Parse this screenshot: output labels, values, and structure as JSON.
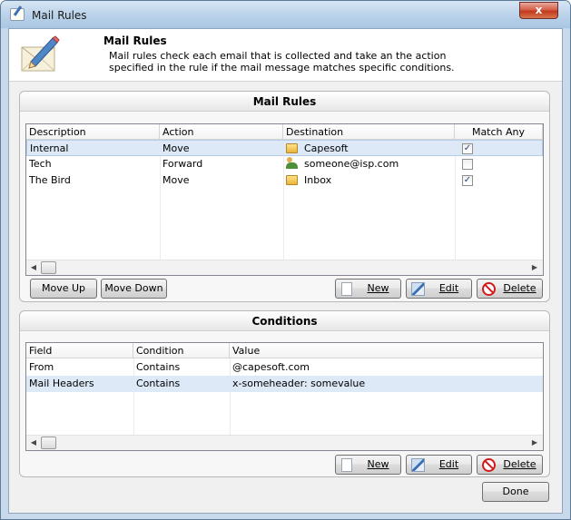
{
  "window": {
    "title": "Mail Rules",
    "close_glyph": "x",
    "icon": "mail-rules-icon"
  },
  "header": {
    "title": "Mail Rules",
    "description": "Mail rules check each email that is collected and take an the action specified in the rule if the mail message matches specific conditions.",
    "icon": "envelope-pencil-icon"
  },
  "rules_group": {
    "title": "Mail Rules",
    "columns": [
      "Description",
      "Action",
      "Destination",
      "Match Any"
    ],
    "rows": [
      {
        "description": "Internal",
        "action": "Move",
        "destination": "Capesoft",
        "dest_icon": "folder-icon",
        "match_any": true,
        "selected": true
      },
      {
        "description": "Tech",
        "action": "Forward",
        "destination": "someone@isp.com",
        "dest_icon": "contact-icon",
        "match_any": false,
        "selected": false
      },
      {
        "description": "The Bird",
        "action": "Move",
        "destination": "Inbox",
        "dest_icon": "folder-icon",
        "match_any": true,
        "selected": false
      }
    ],
    "buttons": {
      "move_up": "Move Up",
      "move_down": "Move Down",
      "new": "New",
      "edit": "Edit",
      "delete": "Delete"
    }
  },
  "conditions_group": {
    "title": "Conditions",
    "columns": [
      "Field",
      "Condition",
      "Value"
    ],
    "rows": [
      {
        "field": "From",
        "condition": "Contains",
        "value": "@capesoft.com",
        "selected": false
      },
      {
        "field": "Mail Headers",
        "condition": "Contains",
        "value": "x-someheader: somevalue",
        "selected": true
      }
    ],
    "buttons": {
      "new": "New",
      "edit": "Edit",
      "delete": "Delete"
    }
  },
  "footer": {
    "done": "Done"
  },
  "colors": {
    "selection": "#dde9f7",
    "delete_icon": "#d11a1a",
    "title_bar": "#bcd3ea"
  }
}
